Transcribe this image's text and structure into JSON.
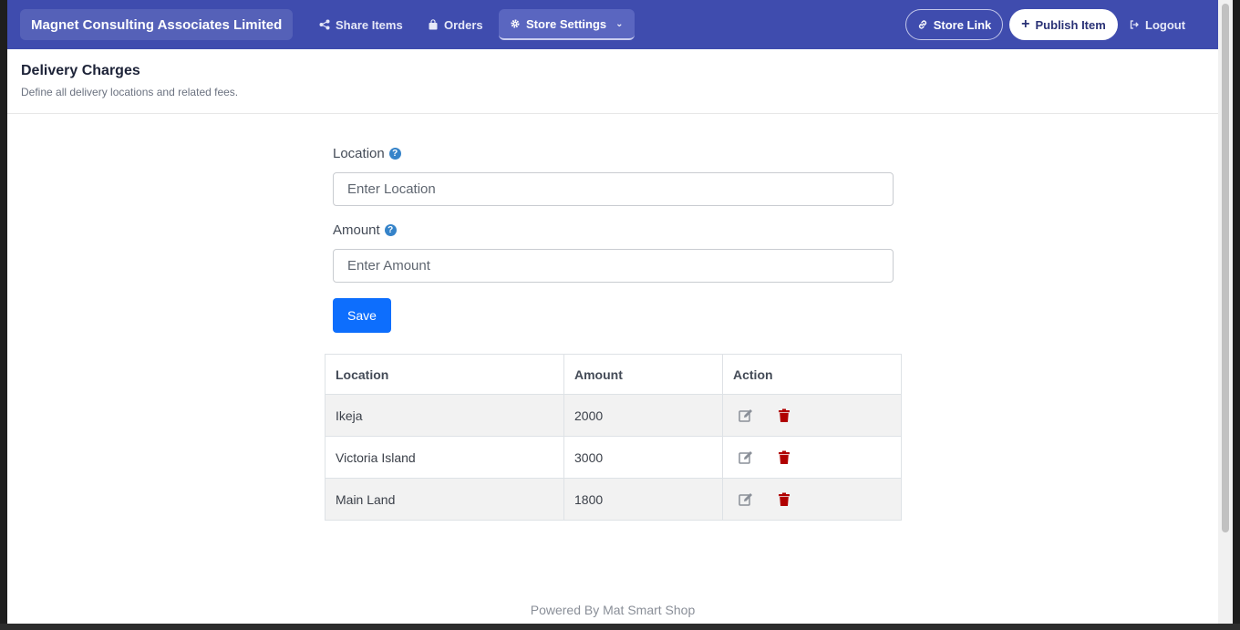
{
  "nav": {
    "brand": "Magnet Consulting Associates Limited",
    "share_items": "Share Items",
    "orders": "Orders",
    "store_settings": "Store Settings",
    "store_link": "Store Link",
    "publish_item": "Publish Item",
    "logout": "Logout"
  },
  "header": {
    "title": "Delivery Charges",
    "subtitle": "Define all delivery locations and related fees."
  },
  "form": {
    "location_label": "Location",
    "location_placeholder": "Enter Location",
    "amount_label": "Amount",
    "amount_placeholder": "Enter Amount",
    "save_label": "Save"
  },
  "table": {
    "headers": [
      "Location",
      "Amount",
      "Action"
    ],
    "rows": [
      {
        "location": "Ikeja",
        "amount": "2000"
      },
      {
        "location": "Victoria Island",
        "amount": "3000"
      },
      {
        "location": "Main Land",
        "amount": "1800"
      }
    ]
  },
  "footer": "Powered By Mat Smart Shop",
  "colors": {
    "navbar": "#3f4cae",
    "primary_button": "#0d6efd",
    "delete_icon": "#b00000"
  }
}
